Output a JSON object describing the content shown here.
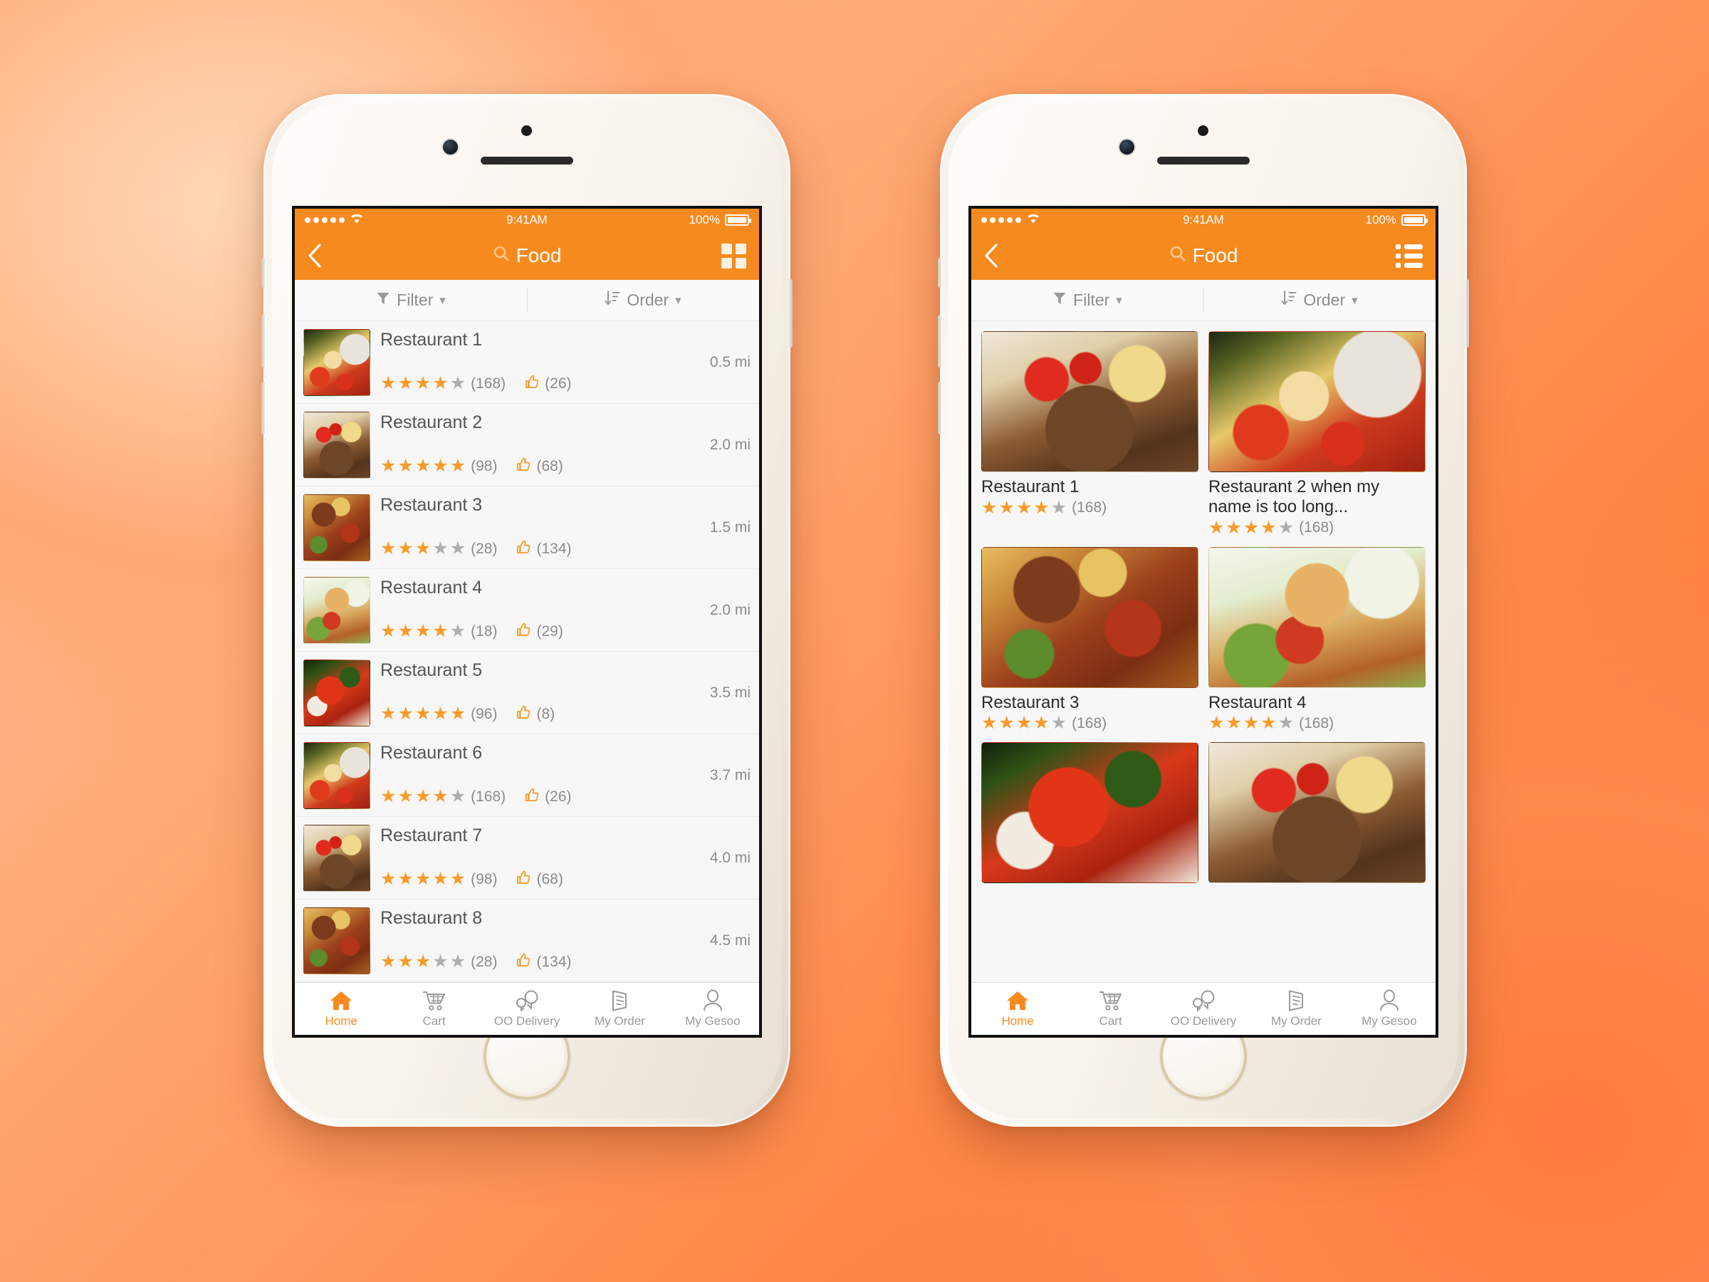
{
  "status_bar": {
    "time": "9:41AM",
    "battery_pct": "100%"
  },
  "colors": {
    "accent": "#F78A1E",
    "star_on": "#F99A29",
    "star_off": "#AEAEAE",
    "text": "#555555"
  },
  "nav": {
    "title": "Food",
    "back_icon": "chevron-left-icon",
    "search_icon": "search-icon"
  },
  "filter_bar": {
    "filter_label": "Filter",
    "order_label": "Order",
    "filter_icon": "funnel-icon",
    "order_icon": "sort-descending-icon",
    "chevron": "chevron-down-icon"
  },
  "tab_bar": {
    "items": [
      {
        "label": "Home",
        "icon": "home-icon",
        "active": true
      },
      {
        "label": "Cart",
        "icon": "shopping-cart-icon",
        "active": false
      },
      {
        "label": "OO Delivery",
        "icon": "delivery-chat-icon",
        "active": false
      },
      {
        "label": "My Order",
        "icon": "receipt-icon",
        "active": false
      },
      {
        "label": "My Gesoo",
        "icon": "user-profile-icon",
        "active": false
      }
    ]
  },
  "left_phone": {
    "view_toggle_icon": "grid-view-icon",
    "list": [
      {
        "name": "Restaurant 1",
        "stars": 4,
        "reviews": "(168)",
        "likes": "(26)",
        "distance": "0.5 mi",
        "photo": "ph-salad"
      },
      {
        "name": "Restaurant 2",
        "stars": 5,
        "reviews": "(98)",
        "likes": "(68)",
        "distance": "2.0 mi",
        "photo": "ph-steak"
      },
      {
        "name": "Restaurant 3",
        "stars": 3,
        "reviews": "(28)",
        "likes": "(134)",
        "distance": "1.5 mi",
        "photo": "ph-taco"
      },
      {
        "name": "Restaurant 4",
        "stars": 4,
        "reviews": "(18)",
        "likes": "(29)",
        "distance": "2.0 mi",
        "photo": "ph-tower"
      },
      {
        "name": "Restaurant 5",
        "stars": 5,
        "reviews": "(96)",
        "likes": "(8)",
        "distance": "3.5 mi",
        "photo": "ph-redfish"
      },
      {
        "name": "Restaurant 6",
        "stars": 4,
        "reviews": "(168)",
        "likes": "(26)",
        "distance": "3.7 mi",
        "photo": "ph-salad"
      },
      {
        "name": "Restaurant 7",
        "stars": 5,
        "reviews": "(98)",
        "likes": "(68)",
        "distance": "4.0 mi",
        "photo": "ph-steak"
      },
      {
        "name": "Restaurant 8",
        "stars": 3,
        "reviews": "(28)",
        "likes": "(134)",
        "distance": "4.5 mi",
        "photo": "ph-taco"
      }
    ]
  },
  "right_phone": {
    "view_toggle_icon": "list-view-icon",
    "grid": [
      {
        "name": "Restaurant 1",
        "stars": 4,
        "reviews": "(168)",
        "photo": "ph-steak"
      },
      {
        "name": "Restaurant 2 when my name is too long...",
        "stars": 4,
        "reviews": "(168)",
        "photo": "ph-salad"
      },
      {
        "name": "Restaurant 3",
        "stars": 4,
        "reviews": "(168)",
        "photo": "ph-taco"
      },
      {
        "name": "Restaurant 4",
        "stars": 4,
        "reviews": "(168)",
        "photo": "ph-tower"
      },
      {
        "name": "",
        "stars": 0,
        "reviews": "",
        "photo": "ph-redfish"
      },
      {
        "name": "",
        "stars": 0,
        "reviews": "",
        "photo": "ph-steak"
      }
    ]
  }
}
